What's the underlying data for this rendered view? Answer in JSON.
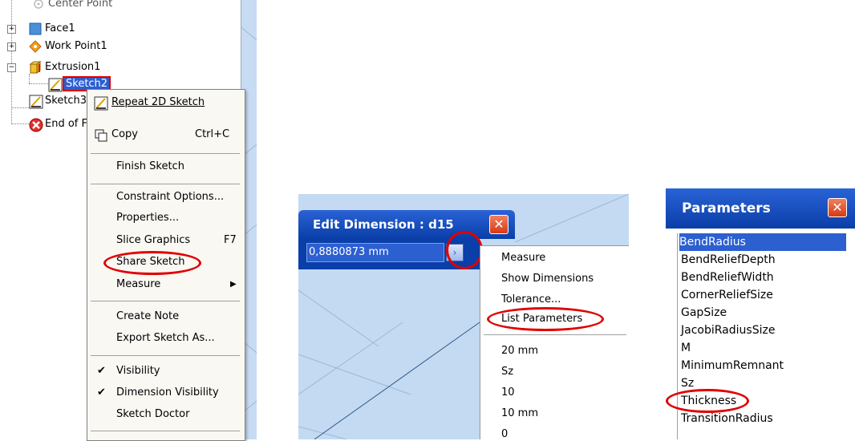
{
  "tree": {
    "items": [
      {
        "label": "Center Point",
        "icon": "center-point-icon"
      },
      {
        "label": "Face1",
        "icon": "face-icon"
      },
      {
        "label": "Work Point1",
        "icon": "work-point-icon"
      },
      {
        "label": "Extrusion1",
        "icon": "extrusion-icon"
      },
      {
        "label": "Sketch2",
        "icon": "sketch-icon"
      },
      {
        "label": "Sketch3",
        "icon": "sketch-icon"
      },
      {
        "label": "End of F",
        "icon": "end-of-part-icon"
      }
    ]
  },
  "context_menu": {
    "items": [
      {
        "label": "Repeat 2D Sketch",
        "shortcut": ""
      },
      {
        "label": "Copy",
        "shortcut": "Ctrl+C"
      },
      {
        "label": "Finish Sketch",
        "shortcut": ""
      },
      {
        "label": "Constraint Options...",
        "shortcut": ""
      },
      {
        "label": "Properties...",
        "shortcut": ""
      },
      {
        "label": "Slice Graphics",
        "shortcut": "F7"
      },
      {
        "label": "Share Sketch",
        "shortcut": ""
      },
      {
        "label": "Measure",
        "shortcut": ""
      },
      {
        "label": "Create Note",
        "shortcut": ""
      },
      {
        "label": "Export Sketch As...",
        "shortcut": ""
      },
      {
        "label": "Visibility",
        "shortcut": ""
      },
      {
        "label": "Dimension Visibility",
        "shortcut": ""
      },
      {
        "label": "Sketch Doctor",
        "shortcut": ""
      }
    ]
  },
  "edit_dimension": {
    "title": "Edit Dimension : d15",
    "value": "0,8880873 mm"
  },
  "dimension_menu": {
    "items": [
      "Measure",
      "Show Dimensions",
      "Tolerance...",
      "List Parameters"
    ],
    "values": [
      "20 mm",
      "Sz",
      "10",
      "10 mm",
      "0"
    ]
  },
  "parameters": {
    "title": "Parameters",
    "items": [
      "BendRadius",
      "BendReliefDepth",
      "BendReliefWidth",
      "CornerReliefSize",
      "GapSize",
      "JacobiRadiusSize",
      "M",
      "MinimumRemnant",
      "Sz",
      "Thickness",
      "TransitionRadius"
    ]
  },
  "colors": {
    "highlight_annotation": "#e00000",
    "title_bar": "#0a3ea8",
    "selection": "#2c5fd0"
  }
}
